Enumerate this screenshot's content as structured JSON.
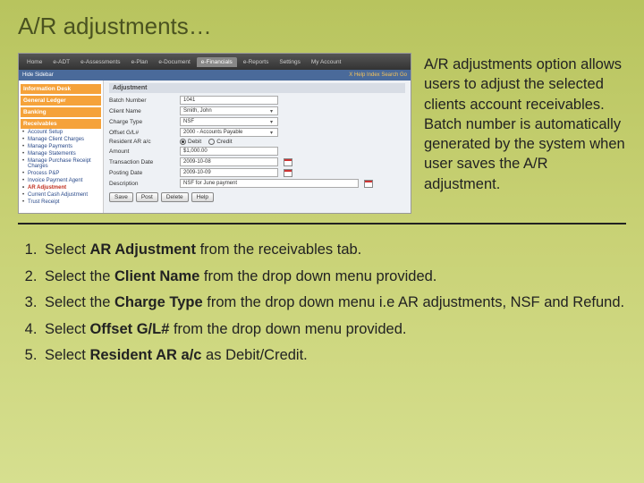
{
  "title": "A/R adjustments…",
  "description": "A/R adjustments option allows users to adjust the selected clients account receivables. Batch number is automatically generated by the system when user saves the A/R adjustment.",
  "screenshot": {
    "topbar": {
      "tabs": [
        "Home",
        "e-ADT",
        "e-Assessments",
        "e-Plan",
        "e-Document",
        "e-Financials",
        "e-Reports",
        "Settings",
        "My Account"
      ],
      "active_index": 5
    },
    "subbar": {
      "left": "Hide Sidebar",
      "right": "X Help  Index  Search Go"
    },
    "sidebar": {
      "sections": [
        {
          "head": "Information Desk",
          "items": []
        },
        {
          "head": "General Ledger",
          "items": []
        },
        {
          "head": "Banking",
          "items": []
        },
        {
          "head": "Receivables",
          "items": [
            "Account Setup",
            "Manage Client Charges",
            "Manage Payments",
            "Manage Statements",
            "Manage Purchase Receipt Charges",
            "Process P&P",
            "Invoice Payment Agent",
            "AR Adjustment",
            "Current Cash Adjustment",
            "Trust Receipt"
          ],
          "selected_index": 7
        }
      ]
    },
    "form": {
      "heading": "Adjustment",
      "fields": {
        "batch_label": "Batch Number",
        "batch_value": "1041",
        "client_label": "Client Name",
        "client_value": "Smith, John",
        "charge_label": "Charge Type",
        "charge_value": "NSF",
        "offset_label": "Offset G/L#",
        "offset_value": "2000 - Accounts Payable",
        "resident_label": "Resident AR a/c",
        "radio_debit": "Debit",
        "radio_credit": "Credit",
        "amount_label": "Amount",
        "amount_value": "$1,000.00",
        "txn_label": "Transaction Date",
        "txn_value": "2009-10-08",
        "post_label": "Posting Date",
        "post_value": "2009-10-09",
        "desc_label": "Description",
        "desc_value": "NSF for June payment"
      },
      "buttons": {
        "save": "Save",
        "post": "Post",
        "delete": "Delete",
        "help": "Help"
      }
    }
  },
  "steps": [
    {
      "pre": "Select ",
      "bold": "AR Adjustment",
      "post": " from the receivables tab."
    },
    {
      "pre": "Select the ",
      "bold": "Client Name",
      "post": " from the drop down menu provided."
    },
    {
      "pre": "Select the ",
      "bold": "Charge Type",
      "post": " from the drop down menu i.e AR adjustments, NSF and Refund."
    },
    {
      "pre": "Select ",
      "bold": "Offset G/L#",
      "post": " from the drop down menu provided."
    },
    {
      "pre": "Select ",
      "bold": "Resident AR a/c",
      "post": " as Debit/Credit."
    }
  ]
}
